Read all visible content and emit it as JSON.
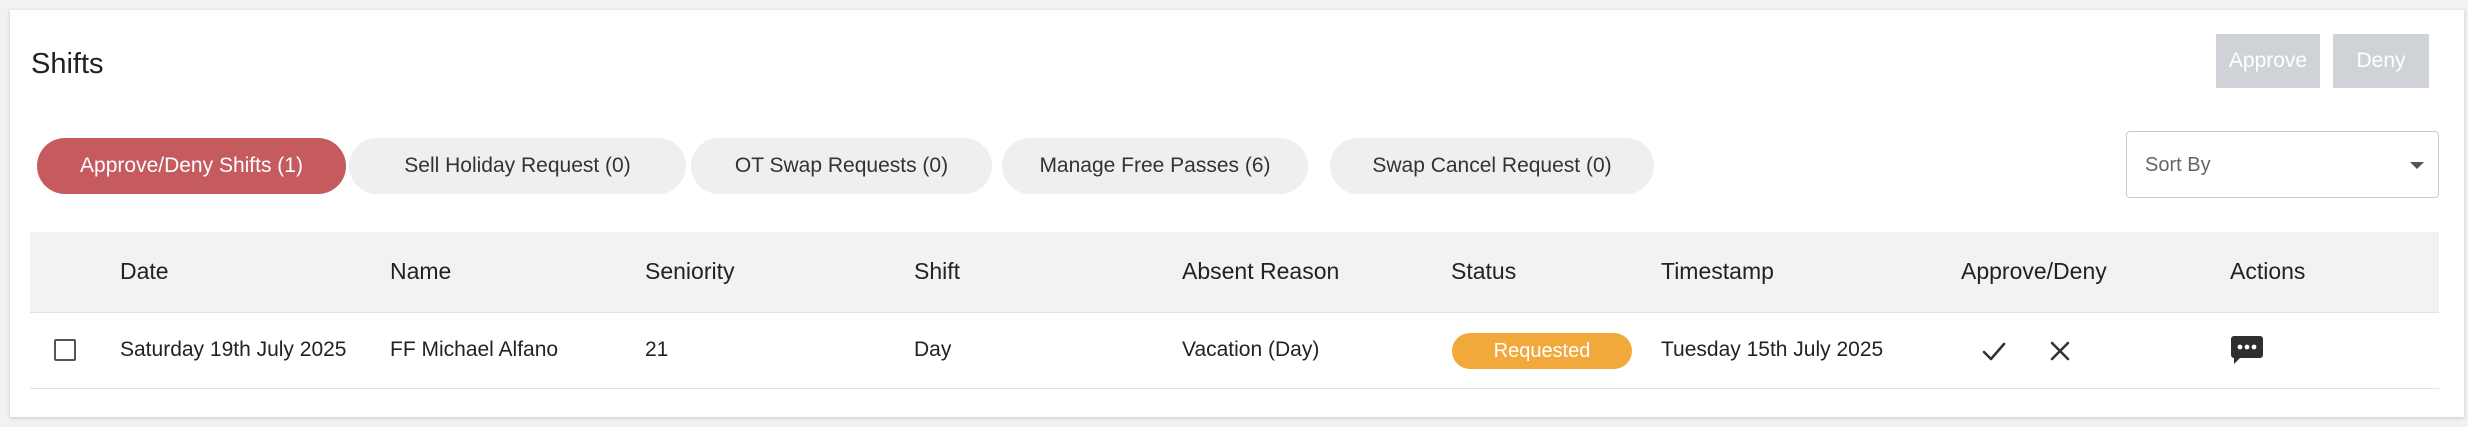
{
  "header": {
    "title": "Shifts",
    "approve_label": "Approve",
    "deny_label": "Deny"
  },
  "tabs": [
    {
      "label": "Approve/Deny Shifts (1)",
      "active": true
    },
    {
      "label": "Sell Holiday Request (0)",
      "active": false
    },
    {
      "label": "OT Swap Requests (0)",
      "active": false
    },
    {
      "label": "Manage Free Passes (6)",
      "active": false
    },
    {
      "label": "Swap Cancel Request (0)",
      "active": false
    }
  ],
  "sort": {
    "placeholder": "Sort By"
  },
  "table": {
    "columns": [
      "Date",
      "Name",
      "Seniority",
      "Shift",
      "Absent Reason",
      "Status",
      "Timestamp",
      "Approve/Deny",
      "Actions"
    ],
    "rows": [
      {
        "date": "Saturday 19th July 2025",
        "name": "FF Michael Alfano",
        "seniority": "21",
        "shift": "Day",
        "absent_reason": "Vacation (Day)",
        "status": "Requested",
        "timestamp": "Tuesday 15th July 2025"
      }
    ]
  },
  "colors": {
    "accent": "#c55a5f",
    "status_requested": "#f1a93b",
    "disabled_button": "#cfd2d6"
  },
  "icons": {
    "approve": "check-icon",
    "deny": "close-icon",
    "actions": "comment-icon",
    "sort": "chevron-down-icon"
  }
}
